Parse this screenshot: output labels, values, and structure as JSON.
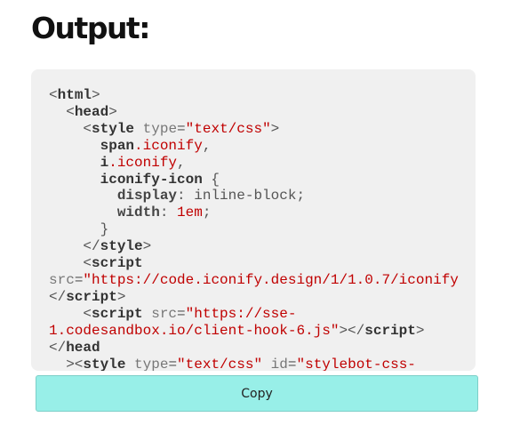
{
  "heading": "Output:",
  "code": {
    "l1": {
      "open": "<",
      "tag": "html",
      "close": ">"
    },
    "l2": {
      "indent": "  ",
      "open": "<",
      "tag": "head",
      "close": ">"
    },
    "l3": {
      "indent": "    ",
      "open": "<",
      "tag": "style",
      "attr": " type",
      "eq": "=",
      "val": "\"text/css\"",
      "close": ">"
    },
    "l4": {
      "indent": "      ",
      "tag": "span",
      "cls": ".iconify",
      "punct": ","
    },
    "l5": {
      "indent": "      ",
      "tag": "i",
      "cls": ".iconify",
      "punct": ","
    },
    "l6": {
      "indent": "      ",
      "tag": "iconify-icon",
      "brace": " {"
    },
    "l7": {
      "indent": "        ",
      "prop": "display",
      "colon": ": ",
      "value": "inline-block",
      "semi": ";"
    },
    "l8": {
      "indent": "        ",
      "prop": "width",
      "colon": ": ",
      "value": "1em",
      "semi": ";"
    },
    "l9": {
      "indent": "      ",
      "brace": "}"
    },
    "l10": {
      "indent": "    ",
      "open": "</",
      "tag": "style",
      "close": ">"
    },
    "l11": {
      "indent": "    ",
      "open": "<",
      "tag": "script"
    },
    "l12": {
      "attr": "src",
      "eq": "=",
      "val": "\"https://code.iconify.design/1/1.0.7/iconify"
    },
    "l13": {
      "open": "</",
      "tag": "script",
      "close": ">"
    },
    "l14": {
      "indent": "    ",
      "open": "<",
      "tag": "script",
      "attr": " src",
      "eq": "=",
      "val": "\"https://sse-"
    },
    "l15": {
      "val": "1.codesandbox.io/client-hook-6.js\"",
      "mid": "></",
      "tag": "script",
      "close": ">"
    },
    "l16": {
      "open": "</",
      "tag": "head"
    },
    "l17": {
      "indent": "  ",
      "open": "><",
      "tag": "style",
      "attr": " type",
      "eq": "=",
      "val": "\"text/css\"",
      "attr2": " id",
      "eq2": "=",
      "val2": "\"stylebot-css-"
    }
  },
  "copy_button": {
    "label": "Copy"
  }
}
